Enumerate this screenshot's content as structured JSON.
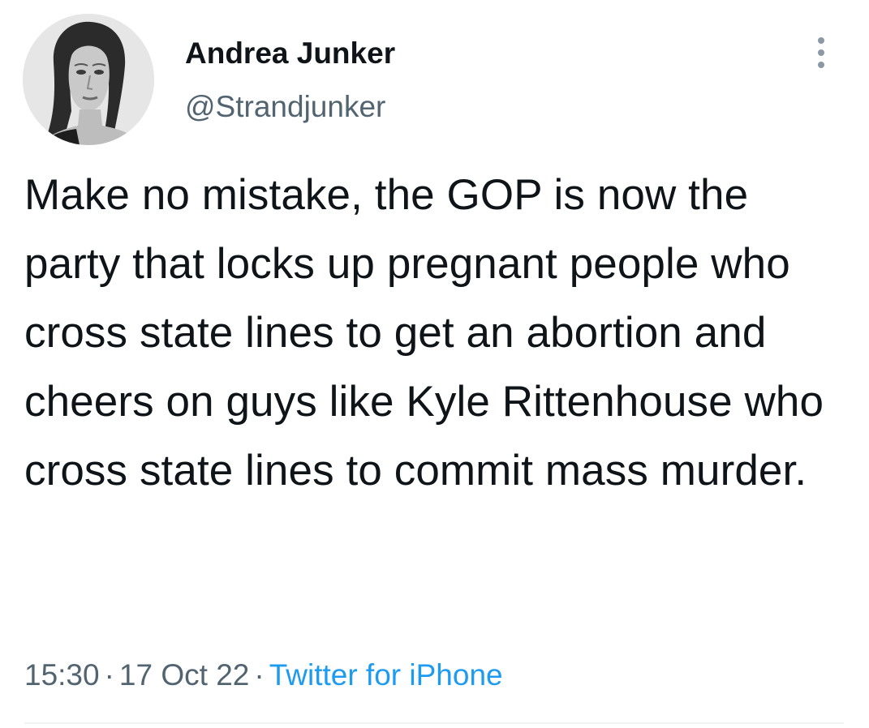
{
  "author": {
    "display_name": "Andrea Junker",
    "handle": "@Strandjunker"
  },
  "tweet": {
    "text": "Make no mistake, the GOP is now the party that locks up pregnant people who cross state lines to get an abortion and cheers on guys like Kyle Rittenhouse who cross state lines to commit mass murder.",
    "time": "15:30",
    "date": "17 Oct 22",
    "separator": "·",
    "source": "Twitter for iPhone"
  },
  "icons": {
    "more": "more-vertical-icon",
    "avatar": "avatar-photo"
  },
  "colors": {
    "text_primary": "#0f1419",
    "text_secondary": "#536471",
    "link": "#1d9bf0",
    "divider": "#eff3f4"
  }
}
